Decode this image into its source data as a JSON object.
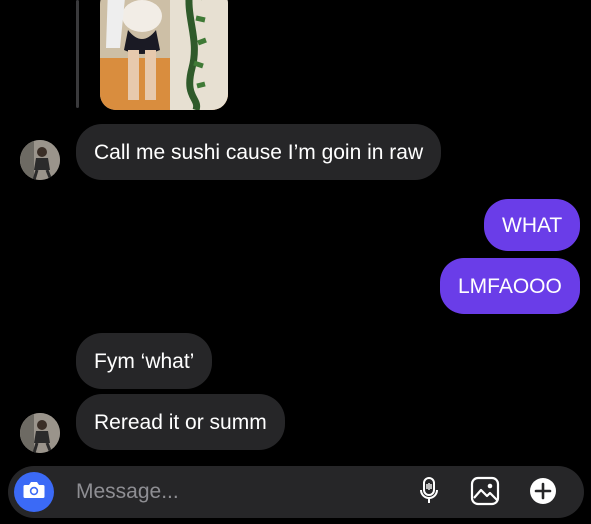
{
  "conversation": {
    "messages": [
      {
        "direction": "incoming",
        "text": "Call me sushi cause I’m goin in raw"
      },
      {
        "direction": "outgoing",
        "text": "WHAT"
      },
      {
        "direction": "outgoing",
        "text": "LMFAOOO"
      },
      {
        "direction": "incoming",
        "text": "Fym ‘what’"
      },
      {
        "direction": "incoming",
        "text": "Reread it or summ"
      }
    ]
  },
  "composer": {
    "placeholder": "Message...",
    "icons": {
      "camera": "camera-icon",
      "microphone": "microphone-icon",
      "gallery": "gallery-icon",
      "add": "plus-icon"
    }
  },
  "colors": {
    "background": "#000000",
    "incoming_bubble": "#262628",
    "outgoing_bubble": "#6a3de8",
    "camera_button": "#3b6af6"
  }
}
